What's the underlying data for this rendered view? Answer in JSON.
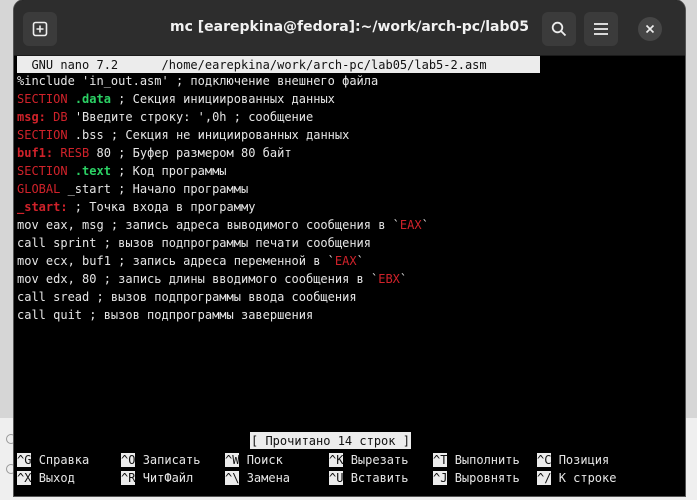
{
  "window": {
    "title": "mc [earepkina@fedora]:~/work/arch-pc/lab05"
  },
  "nano": {
    "version": "  GNU nano 7.2",
    "file_path": "/home/earepkina/work/arch-pc/lab05/lab5-2.asm",
    "status": "[ Прочитано 14 строк ]"
  },
  "code": {
    "l1": "%include 'in_out.asm' ; подключение внешнего файла",
    "l2_kw": "SECTION",
    "l2_dir": ".data",
    "l2_rest": " ; Секция инициированных данных",
    "l3_lbl": "msg:",
    "l3_kw": "DB",
    "l3_rest": " 'Введите строку: ',0h ; сообщение",
    "l4_kw": "SECTION",
    "l4_rest": " .bss ; Секция не инициированных данных",
    "l5_lbl": "buf1:",
    "l5_kw": "RESB",
    "l5_rest": " 80 ; Буфер размером 80 байт",
    "l6_kw": "SECTION",
    "l6_dir": ".text",
    "l6_rest": " ; Код программы",
    "l7_kw": "GLOBAL",
    "l7_rest": " _start ; Начало программы",
    "l8_lbl": "_start:",
    "l8_rest": " ; Точка входа в программу",
    "l9_pre": "mov eax, msg ; запись адреса выводимого сообщения в `",
    "l9_reg": "EAX",
    "l9_post": "`",
    "l10": "call sprint ; вызов подпрограммы печати сообщения",
    "l11_pre": "mov ecx, buf1 ; запись адреса переменной в `",
    "l11_reg": "EAX",
    "l11_post": "`",
    "l12_pre": "mov edx, 80 ; запись длины вводимого сообщения в `",
    "l12_reg": "EBX",
    "l12_post": "`",
    "l13": "call sread ; вызов подпрограммы ввода сообщения",
    "l14": "call quit ; вызов подпрограммы завершения"
  },
  "shortcuts": [
    {
      "key": "^G",
      "label": "Справка"
    },
    {
      "key": "^O",
      "label": "Записать"
    },
    {
      "key": "^W",
      "label": "Поиск"
    },
    {
      "key": "^K",
      "label": "Вырезать"
    },
    {
      "key": "^T",
      "label": "Выполнить"
    },
    {
      "key": "^C",
      "label": "Позиция"
    },
    {
      "key": "^X",
      "label": "Выход"
    },
    {
      "key": "^R",
      "label": "ЧитФайл"
    },
    {
      "key": "^\\",
      "label": "Замена"
    },
    {
      "key": "^U",
      "label": "Вставить"
    },
    {
      "key": "^J",
      "label": "Выровнять"
    },
    {
      "key": "^/",
      "label": "К строке"
    }
  ],
  "colors": {
    "keyword": "#d0222a",
    "directive": "#2bd164",
    "titlebar": "#2d2d2d",
    "terminal_bg": "#000000"
  },
  "icons": [
    "new-tab-icon",
    "search-icon",
    "menu-icon",
    "close-icon"
  ]
}
